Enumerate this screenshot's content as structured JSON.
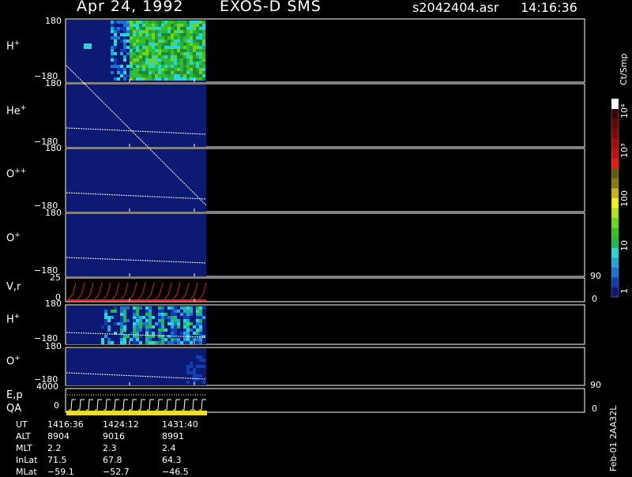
{
  "header": {
    "date": "Apr 24, 1992",
    "instrument": "EXOS-D SMS",
    "file": "s2042404.asr",
    "time": "14:16:36"
  },
  "panels": [
    {
      "id": "h_plus_1",
      "label": "H",
      "sup": "+",
      "top_tick": "180",
      "bottom_tick": "−180"
    },
    {
      "id": "he_plus",
      "label": "He",
      "sup": "+",
      "top_tick": "180",
      "bottom_tick": "−180"
    },
    {
      "id": "o_plusplus",
      "label": "O",
      "sup": "++",
      "top_tick": "180",
      "bottom_tick": "−180"
    },
    {
      "id": "o_plus_1",
      "label": "O",
      "sup": "+",
      "top_tick": "180",
      "bottom_tick": "−180"
    },
    {
      "id": "vr",
      "label": "V,r",
      "sup": "",
      "top_tick": "25",
      "bottom_tick": "0",
      "right_top": "90",
      "right_bottom": "0"
    },
    {
      "id": "h_plus_2",
      "label": "H",
      "sup": "+",
      "top_tick": "180",
      "bottom_tick": "−180"
    },
    {
      "id": "o_plus_2",
      "label": "O",
      "sup": "+",
      "top_tick": "180",
      "bottom_tick": "−180"
    },
    {
      "id": "ep",
      "label": "E,p",
      "sup": "",
      "top_tick": "4000",
      "bottom_tick": "0",
      "right_top": "90",
      "right_bottom": "0"
    }
  ],
  "qa_label": "QA",
  "colorbar": {
    "unit_label": "Ct/Smp",
    "tick_labels": [
      "1",
      "10",
      "100",
      "10³",
      "10⁴"
    ],
    "colors": [
      "#0d1a73",
      "#123fb0",
      "#1e70d2",
      "#23a6d6",
      "#2ad6d2",
      "#22b94a",
      "#38c022",
      "#6bd61c",
      "#b6e01c",
      "#f0f020",
      "#c8b414",
      "#8a7a14",
      "#6a5a10",
      "#e81a10",
      "#c01010",
      "#a00e0e",
      "#800a0a",
      "#600808",
      "#3a0505",
      "#ffffff"
    ]
  },
  "footer": {
    "rows": [
      {
        "name": "UT",
        "v": [
          "1416:36",
          "1424:12",
          "1431:40"
        ]
      },
      {
        "name": "ALT",
        "v": [
          "8904",
          "9016",
          "8991"
        ]
      },
      {
        "name": "MLT",
        "v": [
          "2.2",
          "2.3",
          "2.4"
        ]
      },
      {
        "name": "InLat",
        "v": [
          "71.5",
          "67.8",
          "64.3"
        ]
      },
      {
        "name": "MLat",
        "v": [
          "−59.1",
          "−52.7",
          "−46.5"
        ]
      }
    ],
    "side_note": "Feb-01 2AA32L"
  },
  "chart_data": {
    "type": "heatmap",
    "title": "Apr 24, 1992 EXOS-D SMS",
    "x_ticks": [
      "1416:36",
      "1424:12",
      "1431:40"
    ],
    "panels": [
      "H+",
      "He+",
      "O++",
      "O+",
      "V,r",
      "H+",
      "O+",
      "E,p"
    ],
    "ylim_angle": [
      -180,
      180
    ],
    "ylim_vr": [
      0,
      25
    ],
    "ylim_ep": [
      0,
      4000
    ],
    "colorbar_range": [
      1,
      10000
    ],
    "colorbar_scale": "log"
  }
}
